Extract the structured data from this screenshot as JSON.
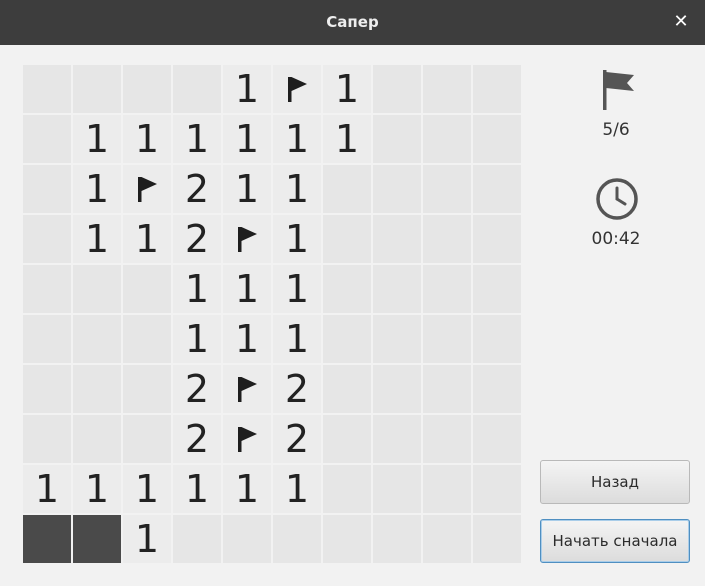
{
  "window": {
    "title": "Сапер",
    "close_glyph": "✕"
  },
  "board": {
    "rows": [
      [
        "",
        "",
        "",
        "",
        "1",
        "F",
        "1",
        "",
        "",
        ""
      ],
      [
        "",
        "1",
        "1",
        "1",
        "1",
        "1",
        "1",
        "",
        "",
        ""
      ],
      [
        "",
        "1",
        "F",
        "2",
        "1",
        "1",
        "",
        "",
        "",
        ""
      ],
      [
        "",
        "1",
        "1",
        "2",
        "F",
        "1",
        "",
        "",
        "",
        ""
      ],
      [
        "",
        "",
        "",
        "1",
        "1",
        "1",
        "",
        "",
        "",
        ""
      ],
      [
        "",
        "",
        "",
        "1",
        "1",
        "1",
        "",
        "",
        "",
        ""
      ],
      [
        "",
        "",
        "",
        "2",
        "F",
        "2",
        "",
        "",
        "",
        ""
      ],
      [
        "",
        "",
        "",
        "2",
        "F",
        "2",
        "",
        "",
        "",
        ""
      ],
      [
        "1",
        "1",
        "1",
        "1",
        "1",
        "1",
        "",
        "",
        "",
        ""
      ],
      [
        "D",
        "D",
        "1",
        "",
        "",
        "",
        "",
        "",
        "",
        ""
      ]
    ],
    "legend": {
      "F": "flag-icon",
      "D": "unopened-dark-cell"
    }
  },
  "status": {
    "flag_icon": "flag-icon",
    "flags": "5/6",
    "clock_icon": "clock-icon",
    "time": "00:42"
  },
  "buttons": {
    "back_label": "Назад",
    "restart_label": "Начать сначала"
  },
  "colors": {
    "titlebar": "#3d3d3d",
    "background": "#f2f2f2",
    "cell_hidden": "#e6e6e6",
    "cell_dark": "#4a4a4a",
    "focus_border": "#4f8fc1"
  }
}
